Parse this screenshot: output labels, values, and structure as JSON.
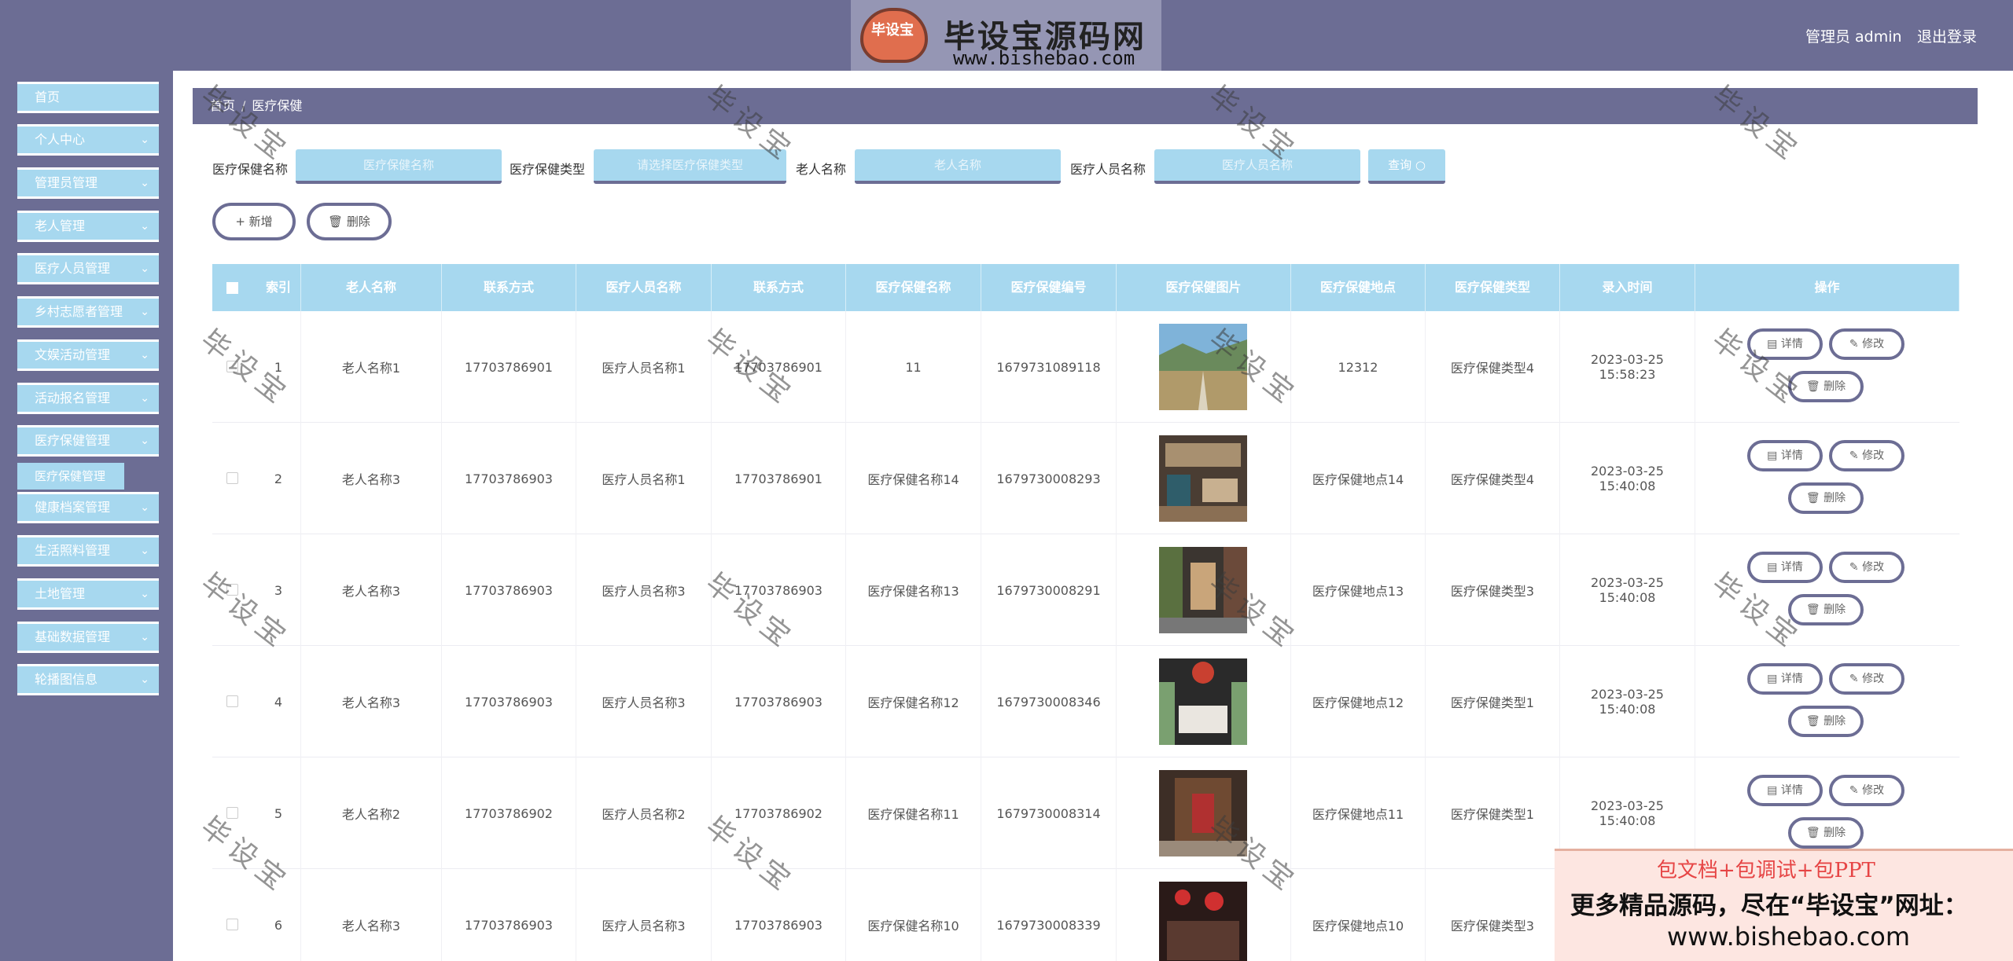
{
  "header": {
    "logo_title": "毕设宝源码网",
    "logo_url": "www.bishebao.com",
    "logo_mark": "毕设宝",
    "admin_label": "管理员 admin",
    "logout_label": "退出登录"
  },
  "sidebar": {
    "items": [
      {
        "label": "首页",
        "has_chevron": false
      },
      {
        "label": "个人中心",
        "has_chevron": true
      },
      {
        "label": "管理员管理",
        "has_chevron": true
      },
      {
        "label": "老人管理",
        "has_chevron": true
      },
      {
        "label": "医疗人员管理",
        "has_chevron": true
      },
      {
        "label": "乡村志愿者管理",
        "has_chevron": true
      },
      {
        "label": "文娱活动管理",
        "has_chevron": true
      },
      {
        "label": "活动报名管理",
        "has_chevron": true
      },
      {
        "label": "医疗保健管理",
        "has_chevron": true
      },
      {
        "label": "健康档案管理",
        "has_chevron": true
      },
      {
        "label": "生活照料管理",
        "has_chevron": true
      },
      {
        "label": "土地管理",
        "has_chevron": true
      },
      {
        "label": "基础数据管理",
        "has_chevron": true
      },
      {
        "label": "轮播图信息",
        "has_chevron": true
      }
    ],
    "active_sub": "医疗保健管理"
  },
  "breadcrumb": {
    "home": "首页",
    "sep": "/",
    "current": "医疗保健"
  },
  "search": {
    "name_label": "医疗保健名称",
    "name_placeholder": "医疗保健名称",
    "type_label": "医疗保健类型",
    "type_placeholder": "请选择医疗保健类型",
    "elder_label": "老人名称",
    "elder_placeholder": "老人名称",
    "staff_label": "医疗人员名称",
    "staff_placeholder": "医疗人员名称",
    "query_label": "查询 ○"
  },
  "actions": {
    "add_label": "+ 新增",
    "delete_label": "🗑 删除"
  },
  "table": {
    "headers": [
      "索引",
      "老人名称",
      "联系方式",
      "医疗人员名称",
      "联系方式",
      "医疗保健名称",
      "医疗保健编号",
      "医疗保健图片",
      "医疗保健地点",
      "医疗保健类型",
      "录入时间",
      "操作"
    ],
    "rows": [
      {
        "index": "1",
        "elder": "老人名称1",
        "elder_phone": "17703786901",
        "staff": "医疗人员名称1",
        "staff_phone": "17703786901",
        "name": "11",
        "code": "1679731089118",
        "image": "mountain-road",
        "place": "12312",
        "type": "医疗保健类型4",
        "time": "2023-03-25 15:58:23"
      },
      {
        "index": "2",
        "elder": "老人名称3",
        "elder_phone": "17703786903",
        "staff": "医疗人员名称1",
        "staff_phone": "17703786901",
        "name": "医疗保健名称14",
        "code": "1679730008293",
        "image": "restaurant-interior",
        "place": "医疗保健地点14",
        "type": "医疗保健类型4",
        "time": "2023-03-25 15:40:08"
      },
      {
        "index": "3",
        "elder": "老人名称3",
        "elder_phone": "17703786903",
        "staff": "医疗人员名称3",
        "staff_phone": "17703786903",
        "name": "医疗保健名称13",
        "code": "1679730008291",
        "image": "corridor-interior",
        "place": "医疗保健地点13",
        "type": "医疗保健类型3",
        "time": "2023-03-25 15:40:08"
      },
      {
        "index": "4",
        "elder": "老人名称3",
        "elder_phone": "17703786903",
        "staff": "医疗人员名称3",
        "staff_phone": "17703786903",
        "name": "医疗保健名称12",
        "code": "1679730008346",
        "image": "dining-hall",
        "place": "医疗保健地点12",
        "type": "医疗保健类型1",
        "time": "2023-03-25 15:40:08"
      },
      {
        "index": "5",
        "elder": "老人名称2",
        "elder_phone": "17703786902",
        "staff": "医疗人员名称2",
        "staff_phone": "17703786902",
        "name": "医疗保健名称11",
        "code": "1679730008314",
        "image": "hallway-interior",
        "place": "医疗保健地点11",
        "type": "医疗保健类型1",
        "time": "2023-03-25 15:40:08"
      },
      {
        "index": "6",
        "elder": "老人名称3",
        "elder_phone": "17703786903",
        "staff": "医疗人员名称3",
        "staff_phone": "17703786903",
        "name": "医疗保健名称10",
        "code": "1679730008339",
        "image": "red-lantern-restaurant",
        "place": "医疗保健地点10",
        "type": "医疗保健类型3",
        "time": ""
      }
    ],
    "op_detail": "详情",
    "op_edit": "修改",
    "op_delete": "删除"
  },
  "watermark": "毕设宝",
  "ad": {
    "line1": "包文档+包调试+包PPT",
    "line2": "更多精品源码，尽在“毕设宝”网址：",
    "line3": "www.bishebao.com"
  },
  "colors": {
    "primary": "#6c6d94",
    "accent": "#a7d8ef"
  }
}
